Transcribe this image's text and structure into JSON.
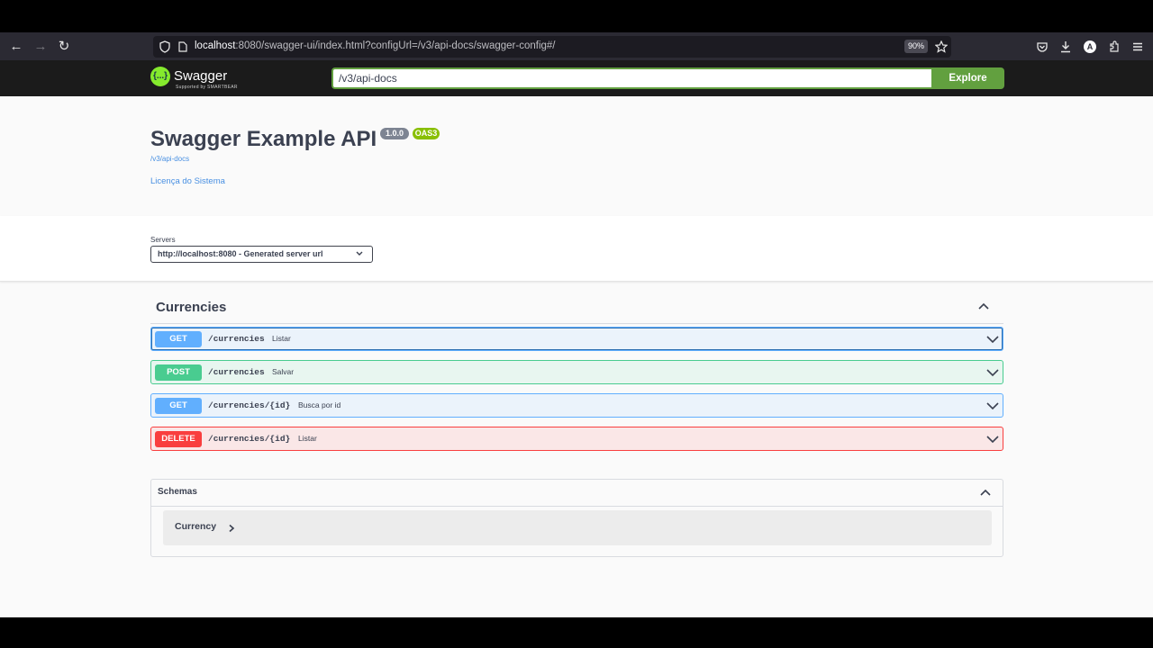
{
  "browser": {
    "url_host": "localhost",
    "url_rest": ":8080/swagger-ui/index.html?configUrl=/v3/api-docs/swagger-config#/",
    "zoom": "90%",
    "profile_initial": "A"
  },
  "topbar": {
    "logo_text": "Swagger",
    "logo_sub": "Supported by SMARTBEAR",
    "logo_mark": "{...}",
    "spec_url": "/v3/api-docs",
    "explore_label": "Explore"
  },
  "info": {
    "title": "Swagger Example API",
    "version": "1.0.0",
    "oas": "OAS3",
    "url": "/v3/api-docs",
    "license": "Licença do Sistema"
  },
  "servers": {
    "label": "Servers",
    "selected": "http://localhost:8080 - Generated server url"
  },
  "tag": {
    "name": "Currencies"
  },
  "operations": [
    {
      "method": "GET",
      "path": "/currencies",
      "summary": "Listar"
    },
    {
      "method": "POST",
      "path": "/currencies",
      "summary": "Salvar"
    },
    {
      "method": "GET",
      "path": "/currencies/{id}",
      "summary": "Busca por id"
    },
    {
      "method": "DELETE",
      "path": "/currencies/{id}",
      "summary": "Listar"
    }
  ],
  "schemas": {
    "title": "Schemas",
    "models": [
      {
        "name": "Currency"
      }
    ]
  },
  "colors": {
    "get": "#61affe",
    "post": "#49cc90",
    "delete": "#f93e3e",
    "accent": "#62a03f"
  }
}
